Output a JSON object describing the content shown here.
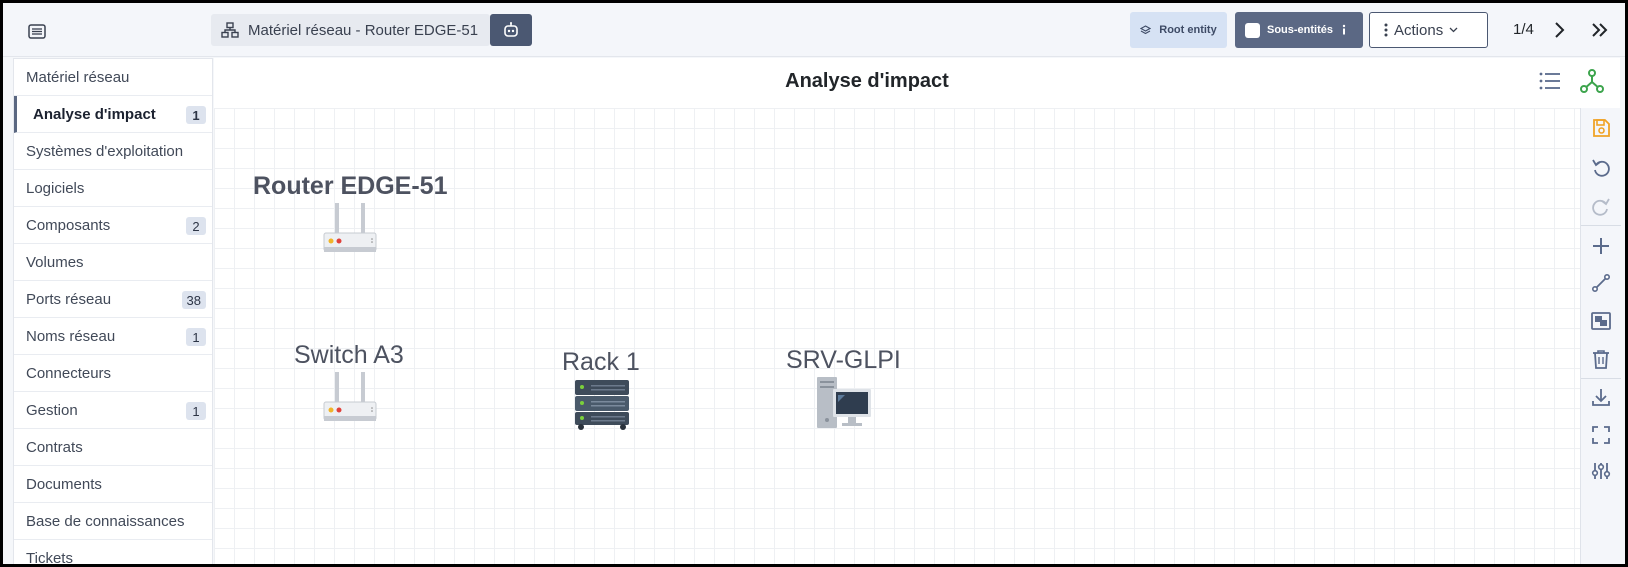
{
  "header": {
    "breadcrumb": "Matériel réseau - Router EDGE-51",
    "root_entity": "Root entity",
    "sous_entites": "Sous-entités",
    "actions": "Actions",
    "pager": "1/4"
  },
  "sidebar": {
    "items": [
      {
        "label": "Matériel réseau",
        "badge": ""
      },
      {
        "label": "Analyse d'impact",
        "badge": "1"
      },
      {
        "label": "Systèmes d'exploitation",
        "badge": ""
      },
      {
        "label": "Logiciels",
        "badge": ""
      },
      {
        "label": "Composants",
        "badge": "2"
      },
      {
        "label": "Volumes",
        "badge": ""
      },
      {
        "label": "Ports réseau",
        "badge": "38"
      },
      {
        "label": "Noms réseau",
        "badge": "1"
      },
      {
        "label": "Connecteurs",
        "badge": ""
      },
      {
        "label": "Gestion",
        "badge": "1"
      },
      {
        "label": "Contrats",
        "badge": ""
      },
      {
        "label": "Documents",
        "badge": ""
      },
      {
        "label": "Base de connaissances",
        "badge": ""
      },
      {
        "label": "Tickets",
        "badge": ""
      }
    ]
  },
  "main": {
    "title": "Analyse d'impact",
    "nodes": [
      {
        "label": "Router EDGE-51",
        "icon": "router-icon"
      },
      {
        "label": "Switch A3",
        "icon": "router-icon"
      },
      {
        "label": "Rack 1",
        "icon": "rack-icon"
      },
      {
        "label": "SRV-GLPI",
        "icon": "computer-icon"
      }
    ]
  },
  "colors": {
    "accent": "#4b5872",
    "save": "#f0a326",
    "graph": "#3da44d"
  }
}
